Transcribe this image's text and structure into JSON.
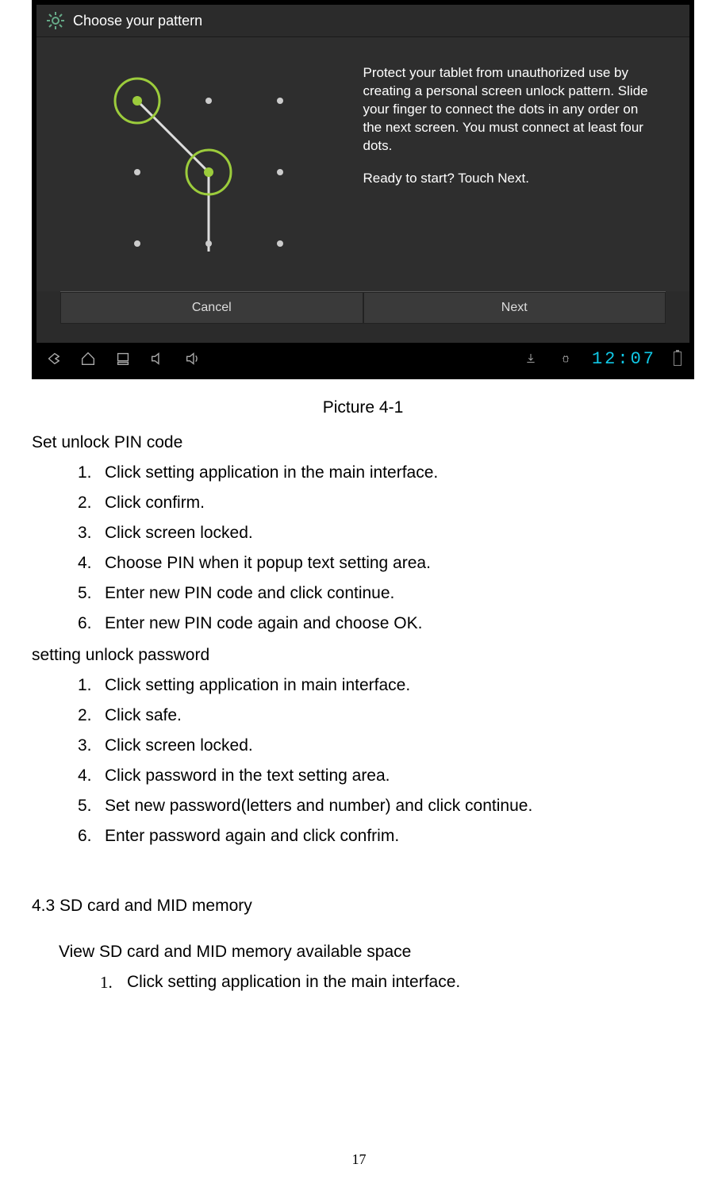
{
  "screenshot": {
    "title": "Choose your pattern",
    "help_para1": "Protect your tablet from unauthorized use by creating a personal screen unlock pattern. Slide your finger to connect the dots in any order on the next screen. You must connect at least four dots.",
    "help_para2": "Ready to start? Touch Next.",
    "btn_cancel": "Cancel",
    "btn_next": "Next",
    "clock": "12:07"
  },
  "caption": "Picture 4-1",
  "pin_head": "Set unlock PIN code",
  "pin_steps": [
    "Click setting application in the main interface.",
    "Click confirm.",
    "Click screen locked.",
    "Choose PIN when it popup text setting area.",
    "Enter new PIN code and click continue.",
    "Enter new PIN code again and choose OK."
  ],
  "pw_head": "setting unlock password",
  "pw_steps": [
    "Click setting application in main interface.",
    "Click safe.",
    "Click screen locked.",
    "Click password in the text setting area.",
    "Set new password(letters and number) and click continue.",
    "Enter password again and click confrim."
  ],
  "sd_head": "4.3 SD card and MID memory",
  "sd_sub": "View SD card and MID memory available space",
  "sd_steps": [
    "Click setting application in the main interface."
  ],
  "page_number": "17"
}
